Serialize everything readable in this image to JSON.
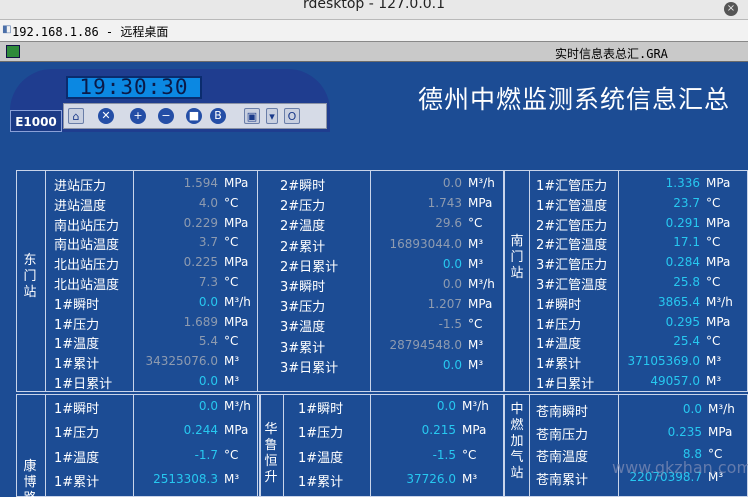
{
  "window": {
    "title": "rdesktop - 127.0.0.1"
  },
  "remote": {
    "title": "192.168.1.86 - 远程桌面"
  },
  "sub": {
    "title": "实时信息表总汇.GRA"
  },
  "panel": {
    "clock": "19:30:30",
    "model": "E1000"
  },
  "system_title": "德州中燃监测系统信息汇总",
  "toolbar": [
    {
      "name": "home-icon",
      "glyph": "⌂"
    },
    {
      "name": "close-icon",
      "glyph": "✕"
    },
    {
      "name": "zoom-in-icon",
      "glyph": "+"
    },
    {
      "name": "zoom-out-icon",
      "glyph": "−"
    },
    {
      "name": "stop-icon",
      "glyph": "■"
    },
    {
      "name": "info-icon",
      "glyph": "B"
    },
    {
      "name": "window-icon",
      "glyph": "▣"
    },
    {
      "name": "dropdown-icon",
      "glyph": "▾"
    },
    {
      "name": "settings-icon",
      "glyph": "O"
    }
  ],
  "stations": {
    "dongmen": {
      "name": "东门站",
      "rows": [
        {
          "label": "进站压力",
          "value": "1.594",
          "unit": "MPa",
          "tone": "g"
        },
        {
          "label": "进站温度",
          "value": "4.0",
          "unit": "°C",
          "tone": "g"
        },
        {
          "label": "南出站压力",
          "value": "0.229",
          "unit": "MPa",
          "tone": "g"
        },
        {
          "label": "南出站温度",
          "value": "3.7",
          "unit": "°C",
          "tone": "g"
        },
        {
          "label": "北出站压力",
          "value": "0.225",
          "unit": "MPa",
          "tone": "g"
        },
        {
          "label": "北出站温度",
          "value": "7.3",
          "unit": "°C",
          "tone": "g"
        },
        {
          "label": "1#瞬时",
          "value": "0.0",
          "unit": "M³/h",
          "tone": "c"
        },
        {
          "label": "1#压力",
          "value": "1.689",
          "unit": "MPa",
          "tone": "g"
        },
        {
          "label": "1#温度",
          "value": "5.4",
          "unit": "°C",
          "tone": "g"
        },
        {
          "label": "1#累计",
          "value": "34325076.0",
          "unit": "M³",
          "tone": "g"
        },
        {
          "label": "1#日累计",
          "value": "0.0",
          "unit": "M³",
          "tone": "c"
        }
      ],
      "rows2": [
        {
          "label": "2#瞬时",
          "value": "0.0",
          "unit": "M³/h",
          "tone": "g"
        },
        {
          "label": "2#压力",
          "value": "1.743",
          "unit": "MPa",
          "tone": "g"
        },
        {
          "label": "2#温度",
          "value": "29.6",
          "unit": "°C",
          "tone": "g"
        },
        {
          "label": "2#累计",
          "value": "16893044.0",
          "unit": "M³",
          "tone": "g"
        },
        {
          "label": "2#日累计",
          "value": "0.0",
          "unit": "M³",
          "tone": "c"
        },
        {
          "label": "3#瞬时",
          "value": "0.0",
          "unit": "M³/h",
          "tone": "g"
        },
        {
          "label": "3#压力",
          "value": "1.207",
          "unit": "MPa",
          "tone": "g"
        },
        {
          "label": "3#温度",
          "value": "-1.5",
          "unit": "°C",
          "tone": "g"
        },
        {
          "label": "3#累计",
          "value": "28794548.0",
          "unit": "M³",
          "tone": "g"
        },
        {
          "label": "3#日累计",
          "value": "0.0",
          "unit": "M³",
          "tone": "c"
        }
      ]
    },
    "nanmen": {
      "name": "南门站",
      "rows": [
        {
          "label": "1#汇管压力",
          "value": "1.336",
          "unit": "MPa",
          "tone": "c"
        },
        {
          "label": "1#汇管温度",
          "value": "23.7",
          "unit": "°C",
          "tone": "c"
        },
        {
          "label": "2#汇管压力",
          "value": "0.291",
          "unit": "MPa",
          "tone": "c"
        },
        {
          "label": "2#汇管温度",
          "value": "17.1",
          "unit": "°C",
          "tone": "c"
        },
        {
          "label": "3#汇管压力",
          "value": "0.284",
          "unit": "MPa",
          "tone": "c"
        },
        {
          "label": "3#汇管温度",
          "value": "25.8",
          "unit": "°C",
          "tone": "c"
        },
        {
          "label": "1#瞬时",
          "value": "3865.4",
          "unit": "M³/h",
          "tone": "c"
        },
        {
          "label": "1#压力",
          "value": "0.295",
          "unit": "MPa",
          "tone": "c"
        },
        {
          "label": "1#温度",
          "value": "25.4",
          "unit": "°C",
          "tone": "c"
        },
        {
          "label": "1#累计",
          "value": "37105369.0",
          "unit": "M³",
          "tone": "c"
        },
        {
          "label": "1#日累计",
          "value": "49057.0",
          "unit": "M³",
          "tone": "c"
        }
      ]
    },
    "kangbo": {
      "name": "康博路",
      "rows": [
        {
          "label": "1#瞬时",
          "value": "0.0",
          "unit": "M³/h",
          "tone": "c"
        },
        {
          "label": "1#压力",
          "value": "0.244",
          "unit": "MPa",
          "tone": "c"
        },
        {
          "label": "1#温度",
          "value": "-1.7",
          "unit": "°C",
          "tone": "c"
        },
        {
          "label": "1#累计",
          "value": "2513308.3",
          "unit": "M³",
          "tone": "c"
        }
      ]
    },
    "hualu": {
      "name": "华鲁恒升",
      "rows": [
        {
          "label": "1#瞬时",
          "value": "0.0",
          "unit": "M³/h",
          "tone": "c"
        },
        {
          "label": "1#压力",
          "value": "0.215",
          "unit": "MPa",
          "tone": "c"
        },
        {
          "label": "1#温度",
          "value": "-1.5",
          "unit": "°C",
          "tone": "c"
        },
        {
          "label": "1#累计",
          "value": "37726.0",
          "unit": "M³",
          "tone": "c"
        }
      ]
    },
    "zhongran": {
      "name": "中燃加气站",
      "rows": [
        {
          "label": "苍南瞬时",
          "value": "0.0",
          "unit": "M³/h",
          "tone": "c"
        },
        {
          "label": "苍南压力",
          "value": "0.235",
          "unit": "MPa",
          "tone": "c"
        },
        {
          "label": "苍南温度",
          "value": "8.8",
          "unit": "°C",
          "tone": "c"
        },
        {
          "label": "苍南累计",
          "value": "22070398.7",
          "unit": "M³",
          "tone": "c"
        }
      ]
    }
  },
  "watermark": "www.gkzhan.com"
}
